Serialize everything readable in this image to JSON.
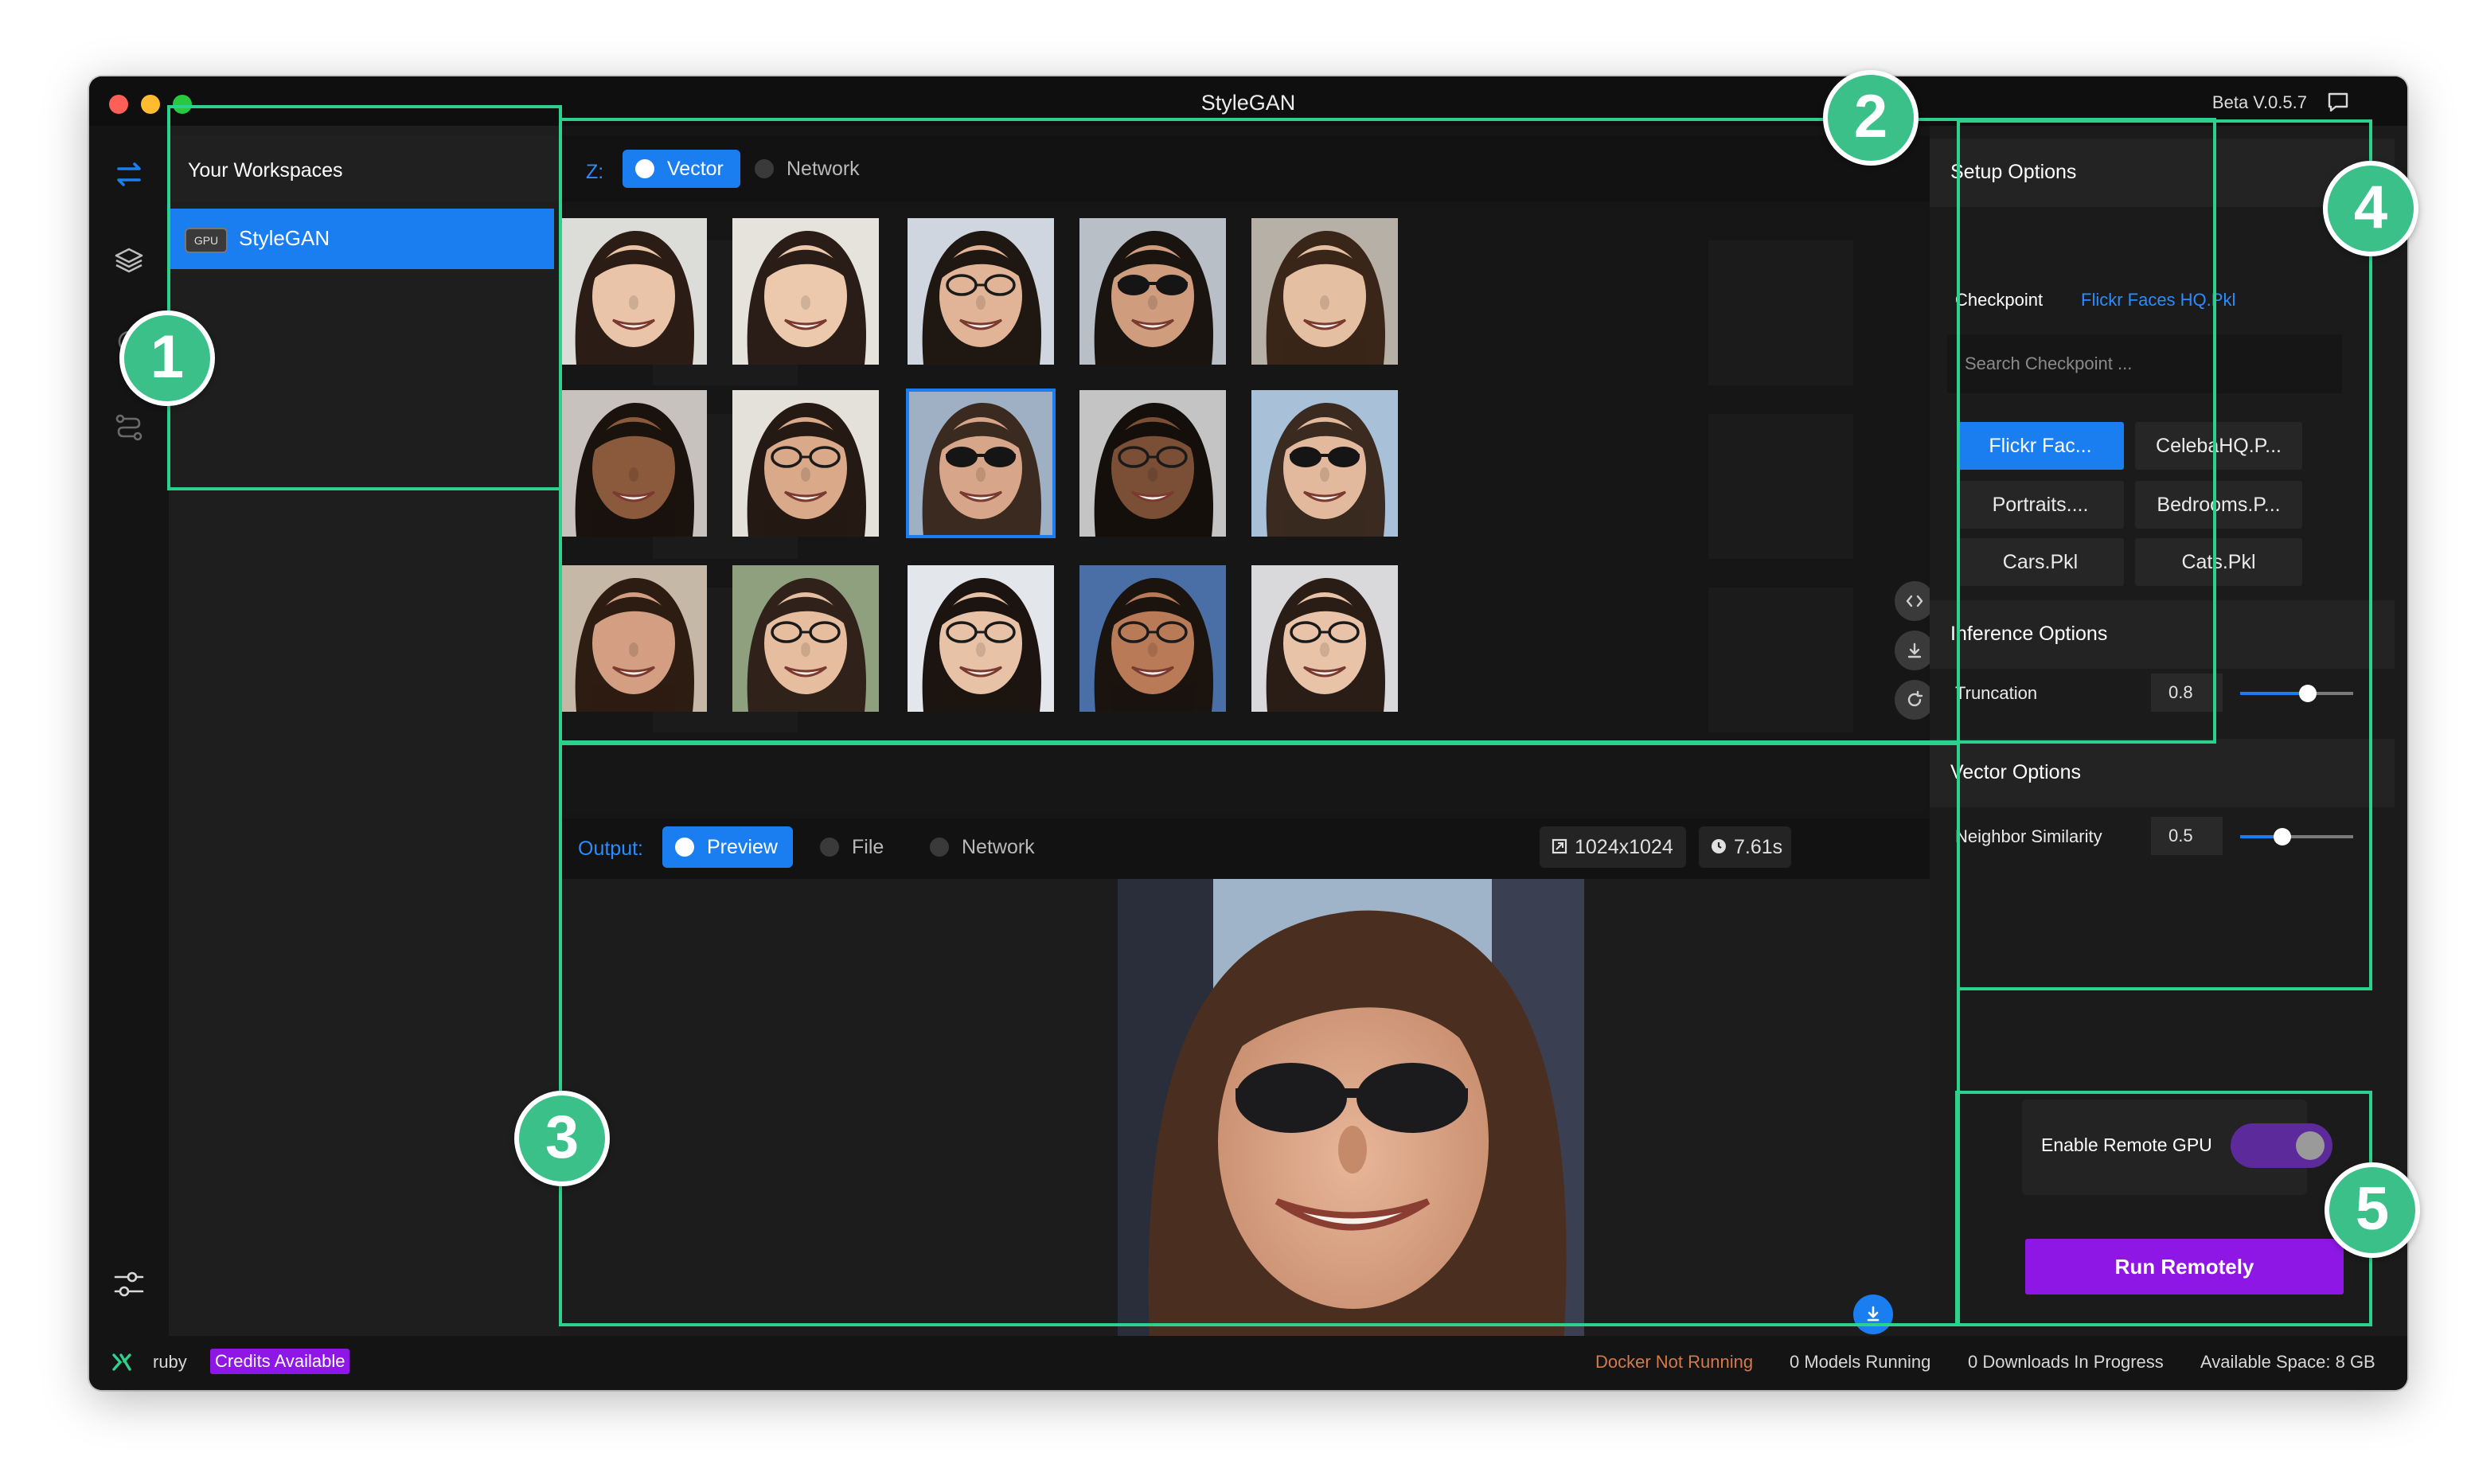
{
  "window": {
    "title": "StyleGAN",
    "version": "Beta V.0.5.7"
  },
  "workspaces": {
    "title": "Your Workspaces",
    "items": [
      {
        "badge": "GPU",
        "label": "StyleGAN"
      }
    ]
  },
  "generator": {
    "prefix": "Z:",
    "tabs": [
      {
        "label": "Vector",
        "active": true
      },
      {
        "label": "Network",
        "active": false
      }
    ],
    "faces": [
      {
        "skin": "#e9c4a8",
        "hair": "#2b1d16",
        "bg": "#dcdcd8",
        "glasses": "none"
      },
      {
        "skin": "#ecc9ad",
        "hair": "#2a1d17",
        "bg": "#e6e3dd",
        "glasses": "none"
      },
      {
        "skin": "#e1b497",
        "hair": "#1f1712",
        "bg": "#cfd6df",
        "glasses": "clear"
      },
      {
        "skin": "#cf9c7e",
        "hair": "#1a1410",
        "bg": "#b8bfc6",
        "glasses": "dark"
      },
      {
        "skin": "#e5bfa2",
        "hair": "#3a2618",
        "bg": "#b6b0a6",
        "glasses": "none"
      },
      {
        "skin": "#8b5a3c",
        "hair": "#1a120d",
        "bg": "#c7c2bd",
        "glasses": "none"
      },
      {
        "skin": "#d9a98a",
        "hair": "#241913",
        "bg": "#e4e0da",
        "glasses": "clear"
      },
      {
        "skin": "#d7a589",
        "hair": "#3b2a1f",
        "bg": "#9fb0c4",
        "glasses": "dark"
      },
      {
        "skin": "#7a4f36",
        "hair": "#140f0b",
        "bg": "#c4c4c4",
        "glasses": "clear"
      },
      {
        "skin": "#e2b99d",
        "hair": "#3a2a1f",
        "bg": "#a8c0d8",
        "glasses": "dark"
      },
      {
        "skin": "#d39e82",
        "hair": "#2d1c12",
        "bg": "#c6b8a6",
        "glasses": "none"
      },
      {
        "skin": "#e6be9f",
        "hair": "#30221a",
        "bg": "#8fa07f",
        "glasses": "clear"
      },
      {
        "skin": "#e8c2a6",
        "hair": "#1c1410",
        "bg": "#e3e6ea",
        "glasses": "clear"
      },
      {
        "skin": "#b97a58",
        "hair": "#1a130e",
        "bg": "#4a6fa6",
        "glasses": "clear"
      },
      {
        "skin": "#e8c3a8",
        "hair": "#2a1d16",
        "bg": "#d9d9db",
        "glasses": "clear"
      }
    ]
  },
  "output": {
    "prefix": "Output:",
    "tabs": [
      {
        "label": "Preview",
        "active": true
      },
      {
        "label": "File",
        "active": false
      },
      {
        "label": "Network",
        "active": false
      }
    ],
    "resolution": "1024x1024",
    "time": "7.61s",
    "mini_buttons": [
      "{ }",
      ">_"
    ]
  },
  "setup": {
    "title": "Setup Options",
    "checkpoint_label": "Checkpoint",
    "checkpoint_value": "Flickr Faces HQ.Pkl",
    "search_placeholder": "Search Checkpoint ...",
    "checkpoints": [
      "Flickr Fac...",
      "CelebaHQ.P...",
      "Portraits....",
      "Bedrooms.P...",
      "Cars.Pkl",
      "Cats.Pkl"
    ]
  },
  "inference": {
    "title": "Inference Options",
    "truncation_label": "Truncation",
    "truncation_value": "0.8",
    "truncation": 0.8
  },
  "vector": {
    "title": "Vector Options",
    "similarity_label": "Neighbor Similarity",
    "similarity_value": "0.5",
    "similarity": 0.5
  },
  "remote": {
    "enable_label": "Enable Remote GPU",
    "enabled": true,
    "run_label": "Run Remotely"
  },
  "status": {
    "user": "ruby",
    "credits": "Credits Available",
    "docker": "Docker Not Running",
    "models": "0 Models Running",
    "downloads": "0 Downloads In Progress",
    "space": "Available Space: 8 GB"
  },
  "callouts": [
    "1",
    "2",
    "3",
    "4",
    "5"
  ],
  "colors": {
    "accent": "#1a7ef0",
    "highlight": "#2dd18e",
    "purple": "#8f17e6",
    "warning": "#d47a4a"
  }
}
